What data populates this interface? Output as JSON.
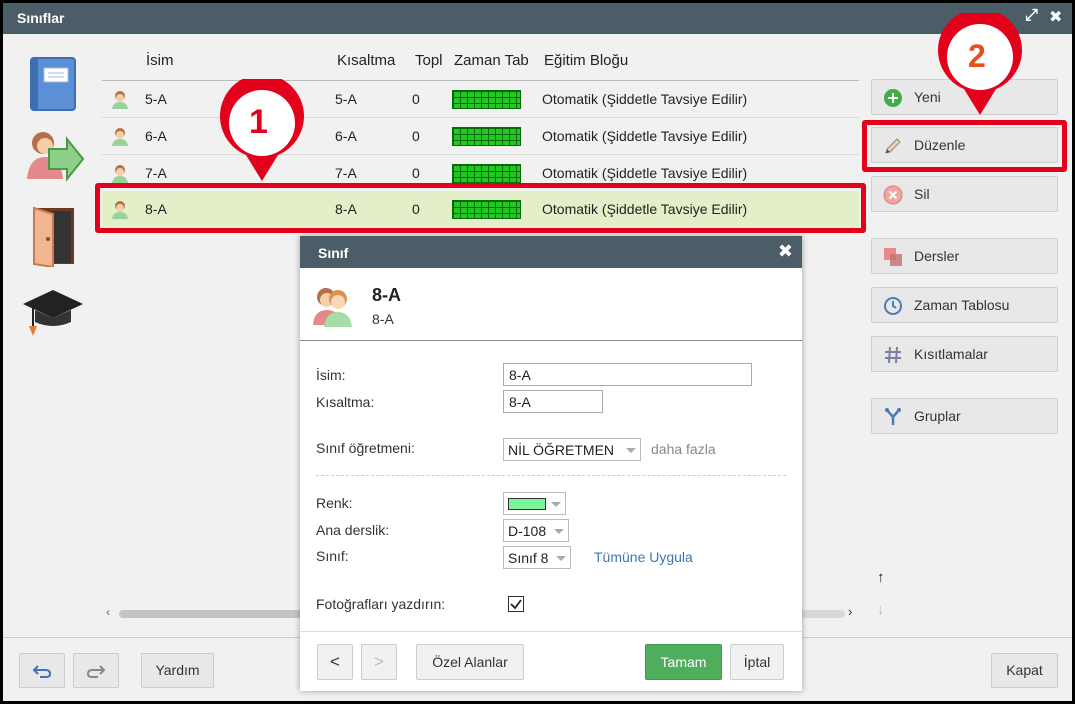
{
  "window": {
    "title": "Sınıflar"
  },
  "table": {
    "headers": {
      "name": "İsim",
      "abbr": "Kısaltma",
      "total": "Topl",
      "timetable": "Zaman Tab",
      "block": "Eğitim Bloğu"
    },
    "rows": [
      {
        "name": "5-A",
        "abbr": "5-A",
        "total": "0",
        "block": "Otomatik (Şiddetle Tavsiye Edilir)"
      },
      {
        "name": "6-A",
        "abbr": "6-A",
        "total": "0",
        "block": "Otomatik (Şiddetle Tavsiye Edilir)"
      },
      {
        "name": "7-A",
        "abbr": "7-A",
        "total": "0",
        "block": "Otomatik (Şiddetle Tavsiye Edilir)"
      },
      {
        "name": "8-A",
        "abbr": "8-A",
        "total": "0",
        "block": "Otomatik (Şiddetle Tavsiye Edilir)"
      }
    ],
    "selected_row": 3
  },
  "right_buttons": {
    "new": "Yeni",
    "edit": "Düzenle",
    "delete": "Sil",
    "lessons": "Dersler",
    "timetable": "Zaman Tablosu",
    "constraints": "Kısıtlamalar",
    "groups": "Gruplar"
  },
  "bottom": {
    "help": "Yardım",
    "close": "Kapat"
  },
  "callouts": {
    "one": "1",
    "two": "2"
  },
  "modal": {
    "title": "Sınıf",
    "heading_name": "8-A",
    "heading_sub": "8-A",
    "fields": {
      "name_label": "İsim:",
      "name_value": "8-A",
      "abbr_label": "Kısaltma:",
      "abbr_value": "8-A",
      "teacher_label": "Sınıf öğretmeni:",
      "teacher_value": "NİL ÖĞRETMEN",
      "more_link": "daha fazla",
      "color_label": "Renk:",
      "color_value": "#7af59a",
      "room_label": "Ana derslik:",
      "room_value": "D-108",
      "grade_label": "Sınıf:",
      "grade_value": "Sınıf 8",
      "apply_all_link": "Tümüne Uygula",
      "print_photos_label": "Fotoğrafları yazdırın:",
      "print_photos_checked": true
    },
    "buttons": {
      "prev": "<",
      "next": ">",
      "custom": "Özel Alanlar",
      "ok": "Tamam",
      "cancel": "İptal"
    }
  },
  "colors": {
    "titlebar": "#4b5d67",
    "ok_green": "#4fae5c",
    "callout_red": "#e2001a",
    "selection": "#e2efc8",
    "timetable_green": "#20c820"
  }
}
